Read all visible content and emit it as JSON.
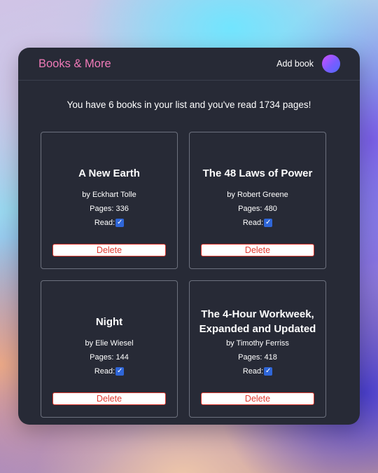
{
  "header": {
    "brand": "Books & More",
    "add_book_label": "Add book"
  },
  "summary": "You have 6 books in your list and you've read 1734 pages!",
  "books": [
    {
      "title": "A New Earth",
      "author": "by Eckhart Tolle",
      "pages": "Pages: 336",
      "read_label": "Read:",
      "read": true,
      "delete_label": "Delete"
    },
    {
      "title": "The 48 Laws of Power",
      "author": "by Robert Greene",
      "pages": "Pages: 480",
      "read_label": "Read:",
      "read": true,
      "delete_label": "Delete"
    },
    {
      "title": "Night",
      "author": "by Elie Wiesel",
      "pages": "Pages: 144",
      "read_label": "Read:",
      "read": true,
      "delete_label": "Delete"
    },
    {
      "title": "The 4-Hour Workweek, Expanded and Updated",
      "author": "by Timothy Ferriss",
      "pages": "Pages: 418",
      "read_label": "Read:",
      "read": true,
      "delete_label": "Delete"
    }
  ],
  "colors": {
    "brand": "#f07ab8",
    "panel": "#272a36",
    "delete": "#e0392f",
    "checkbox": "#2f66d8"
  }
}
